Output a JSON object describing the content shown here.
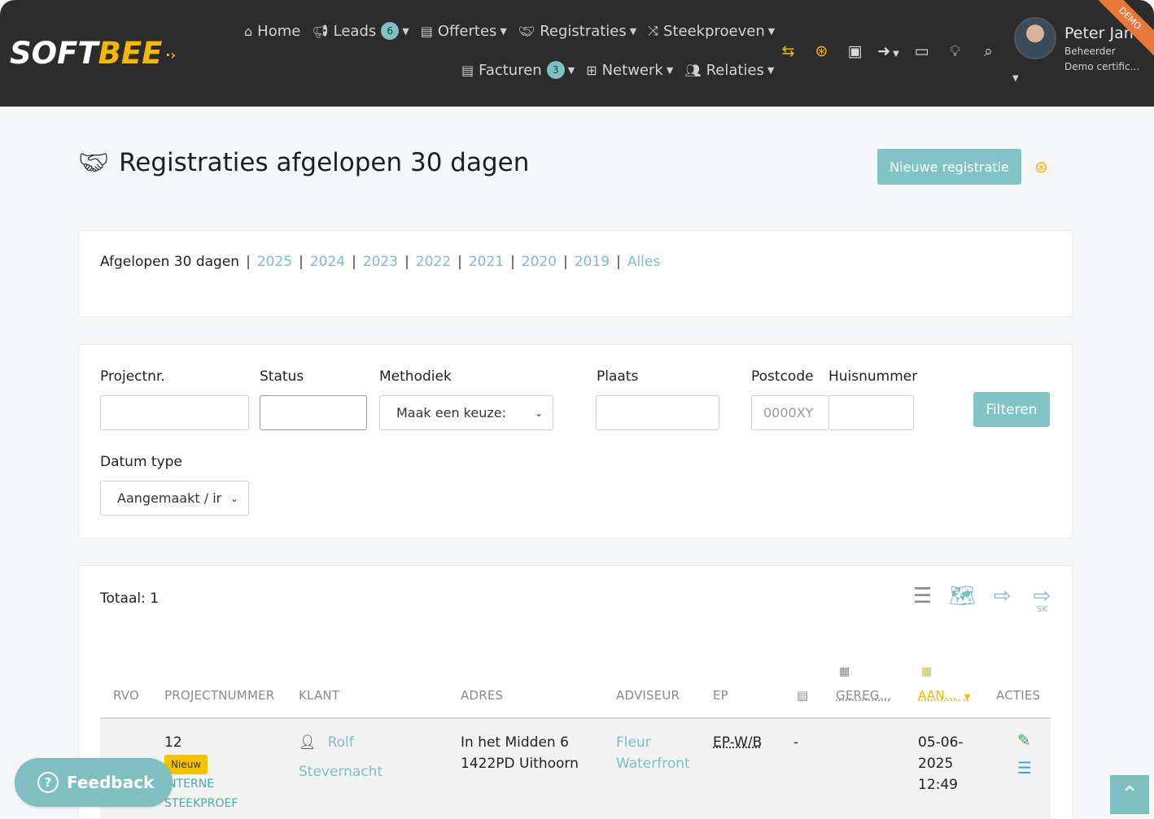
{
  "brand": {
    "logo_soft": "SOFT",
    "logo_bee": "BEE",
    "ribbon": "DEMO"
  },
  "nav": {
    "row1": [
      {
        "label": "Home",
        "icon": "home-icon"
      },
      {
        "label": "Leads",
        "icon": "megaphone-icon",
        "count": "6"
      },
      {
        "label": "Offertes",
        "icon": "document-icon"
      },
      {
        "label": "Registraties",
        "icon": "handshake-icon"
      },
      {
        "label": "Steekproeven",
        "icon": "shuffle-icon"
      }
    ],
    "row2": [
      {
        "label": "Facturen",
        "icon": "invoice-icon",
        "count": "3"
      },
      {
        "label": "Netwerk",
        "icon": "network-icon"
      },
      {
        "label": "Relaties",
        "icon": "users-icon"
      }
    ]
  },
  "user": {
    "name": "Peter Jan",
    "role": "Beheerder",
    "org": "Demo certific..."
  },
  "page": {
    "title": "Registraties afgelopen 30 dagen",
    "new_button": "Nieuwe registratie"
  },
  "period": {
    "active": "Afgelopen 30 dagen",
    "links": [
      "2025",
      "2024",
      "2023",
      "2022",
      "2021",
      "2020",
      "2019",
      "Alles"
    ]
  },
  "filters": {
    "projectnr_label": "Projectnr.",
    "status_label": "Status",
    "methodiek_label": "Methodiek",
    "methodiek_value": "Maak een keuze:",
    "plaats_label": "Plaats",
    "postcode_label": "Postcode",
    "postcode_placeholder": "0000XY",
    "huisnummer_label": "Huisnummer",
    "datum_type_label": "Datum type",
    "datum_type_value": "Aangemaakt / ir",
    "filter_button": "Filteren"
  },
  "results": {
    "total": "Totaal: 1",
    "export_sub": "SK"
  },
  "table": {
    "columns": {
      "rvo": "RVO",
      "projectnummer": "PROJECTNUMMER",
      "klant": "KLANT",
      "adres": "ADRES",
      "adviseur": "ADVISEUR",
      "ep": "EP",
      "gereg": "GEREG...",
      "aan": "AAN...",
      "acties": "ACTIES"
    },
    "row": {
      "projectnummer": "12",
      "badge": "Nieuw",
      "type_line1": "INTERNE",
      "type_line2": "STEEKPROEF",
      "klant_first": "Rolf",
      "klant_last": "Stevernacht",
      "adres_line1": "In het Midden 6",
      "adres_line2": "1422PD Uithoorn",
      "adviseur_line1": "Fleur",
      "adviseur_line2": "Waterfront",
      "ep": "EP-W/B",
      "doc": "-",
      "date_line1": "05-06-",
      "date_line2": "2025",
      "date_line3": "12:49"
    }
  },
  "feedback": {
    "label": "Feedback"
  }
}
